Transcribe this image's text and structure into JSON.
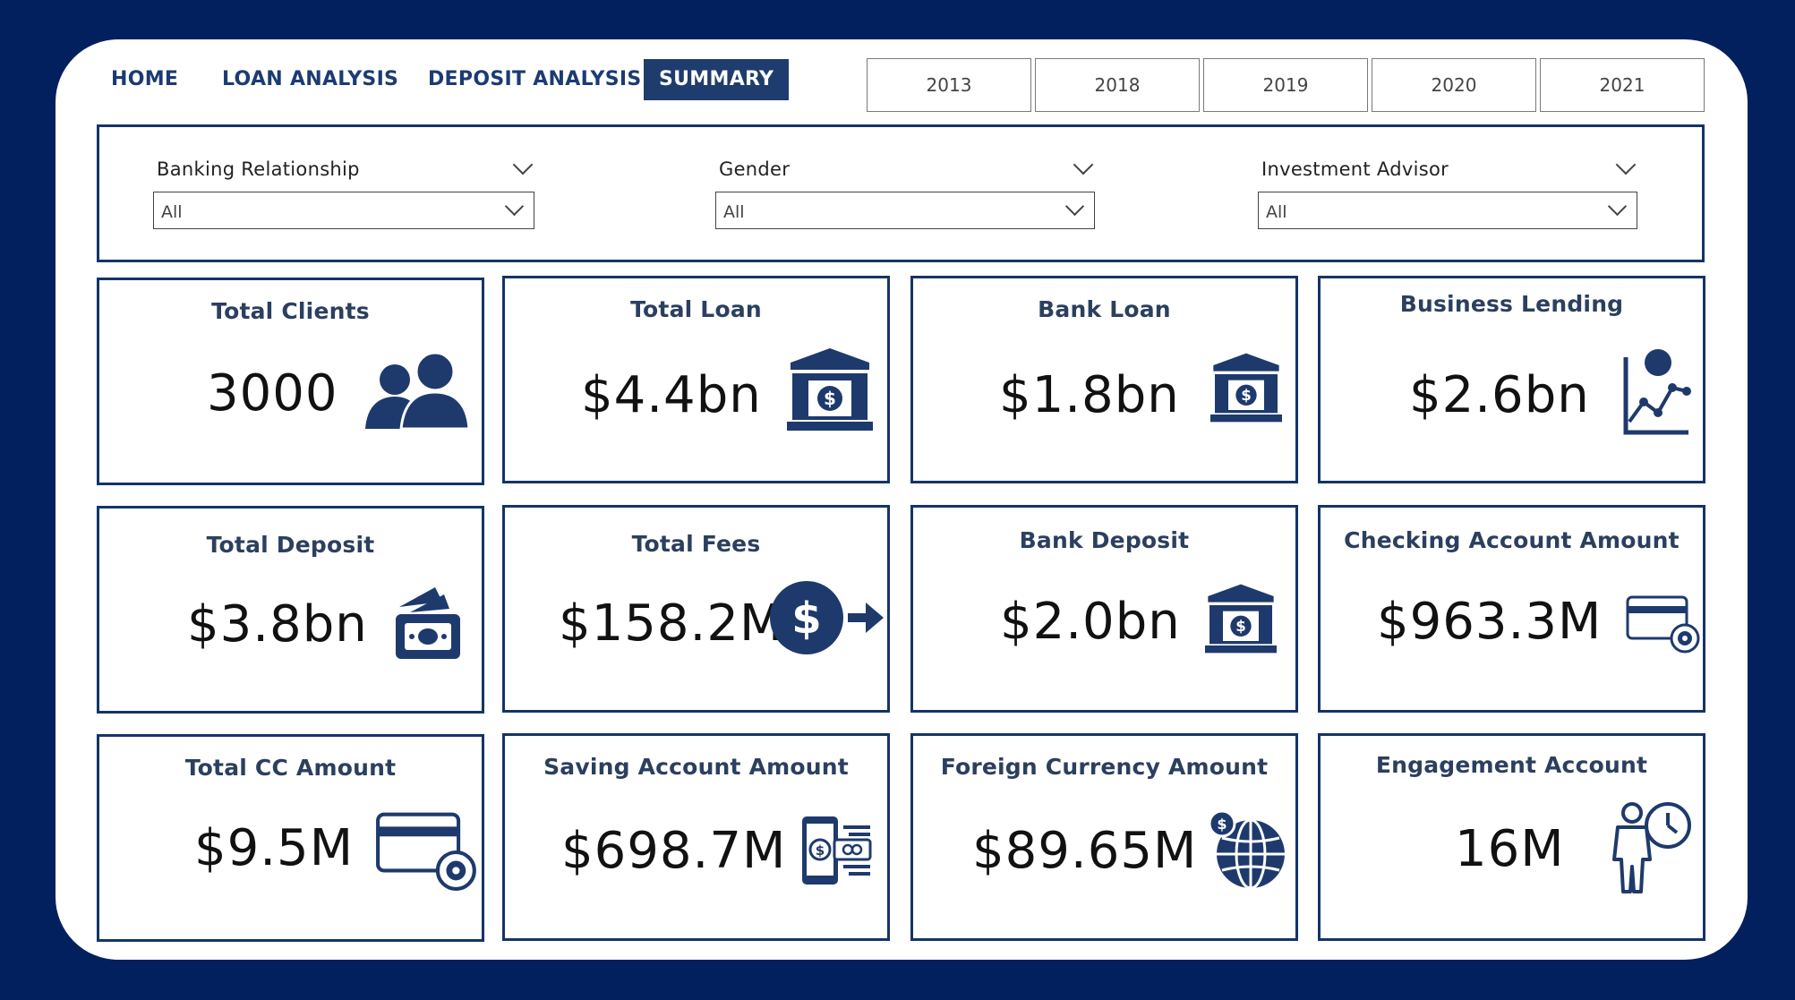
{
  "nav": {
    "tabs": [
      {
        "label": "HOME"
      },
      {
        "label": "LOAN ANALYSIS"
      },
      {
        "label": "DEPOSIT ANALYSIS"
      },
      {
        "label": "SUMMARY"
      }
    ],
    "active_tab": "SUMMARY"
  },
  "years": [
    "2013",
    "2018",
    "2019",
    "2020",
    "2021"
  ],
  "filters": [
    {
      "title": "Banking Relationship",
      "value": "All"
    },
    {
      "title": "Gender",
      "value": "All"
    },
    {
      "title": "Investment Advisor",
      "value": "All"
    }
  ],
  "cards": [
    {
      "title": "Total Clients",
      "value": "3000",
      "icon": "people-icon"
    },
    {
      "title": "Total Loan",
      "value": "$4.4bn",
      "icon": "bank-icon"
    },
    {
      "title": "Bank Loan",
      "value": "$1.8bn",
      "icon": "bank-icon"
    },
    {
      "title": "Business Lending",
      "value": "$2.6bn",
      "icon": "growth-chart-icon"
    },
    {
      "title": "Total Deposit",
      "value": "$3.8bn",
      "icon": "cash-deposit-icon"
    },
    {
      "title": "Total Fees",
      "value": "$158.2M",
      "icon": "dollar-arrow-icon"
    },
    {
      "title": "Bank Deposit",
      "value": "$2.0bn",
      "icon": "bank-icon"
    },
    {
      "title": "Checking Account Amount",
      "value": "$963.3M",
      "icon": "card-gear-icon"
    },
    {
      "title": "Total CC Amount",
      "value": "$9.5M",
      "icon": "card-gear-icon"
    },
    {
      "title": "Saving Account Amount",
      "value": "$698.7M",
      "icon": "mobile-payment-icon"
    },
    {
      "title": "Foreign Currency Amount",
      "value": "$89.65M",
      "icon": "globe-dollar-icon"
    },
    {
      "title": "Engagement Account",
      "value": "16M",
      "icon": "person-clock-icon"
    }
  ],
  "colors": {
    "background": "#03205e",
    "panel": "#ffffff",
    "border": "#143468",
    "icon": "#1e3a6d",
    "active_tab_bg": "#1f3c6e"
  }
}
